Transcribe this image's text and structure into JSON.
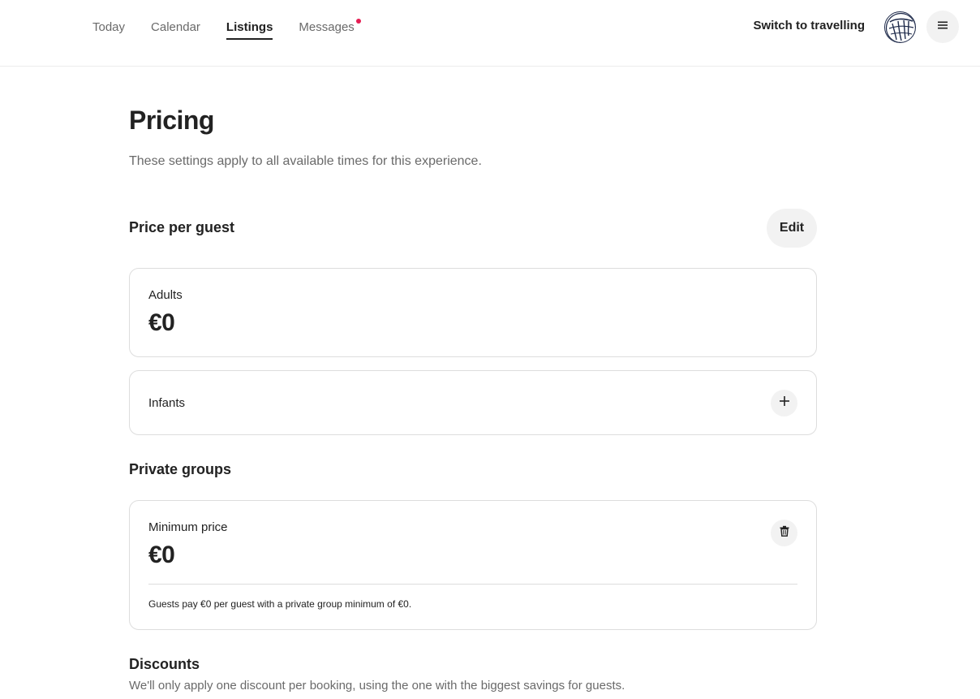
{
  "nav": {
    "items": [
      {
        "label": "Today",
        "active": false
      },
      {
        "label": "Calendar",
        "active": false
      },
      {
        "label": "Listings",
        "active": true
      },
      {
        "label": "Messages",
        "active": false,
        "has_notification": true
      }
    ],
    "switch_label": "Switch to travelling",
    "menu_icon": "hamburger-icon",
    "avatar_icon": "globe-avatar-icon"
  },
  "page": {
    "title": "Pricing",
    "subtitle": "These settings apply to all available times for this experience."
  },
  "price_per_guest": {
    "heading": "Price per guest",
    "edit_label": "Edit",
    "adults": {
      "label": "Adults",
      "value": "€0"
    },
    "infants": {
      "label": "Infants",
      "icon": "plus-icon"
    }
  },
  "private_groups": {
    "heading": "Private groups",
    "minimum": {
      "label": "Minimum price",
      "value": "€0",
      "icon": "trash-icon"
    },
    "note": "Guests pay €0 per guest with a private group minimum of €0."
  },
  "discounts": {
    "heading": "Discounts",
    "subtitle": "We'll only apply one discount per booking, using the one with the biggest savings for guests."
  },
  "colors": {
    "accent": "#e51d53",
    "text": "#222222",
    "muted": "#6a6a6a",
    "border": "#dddddd"
  }
}
